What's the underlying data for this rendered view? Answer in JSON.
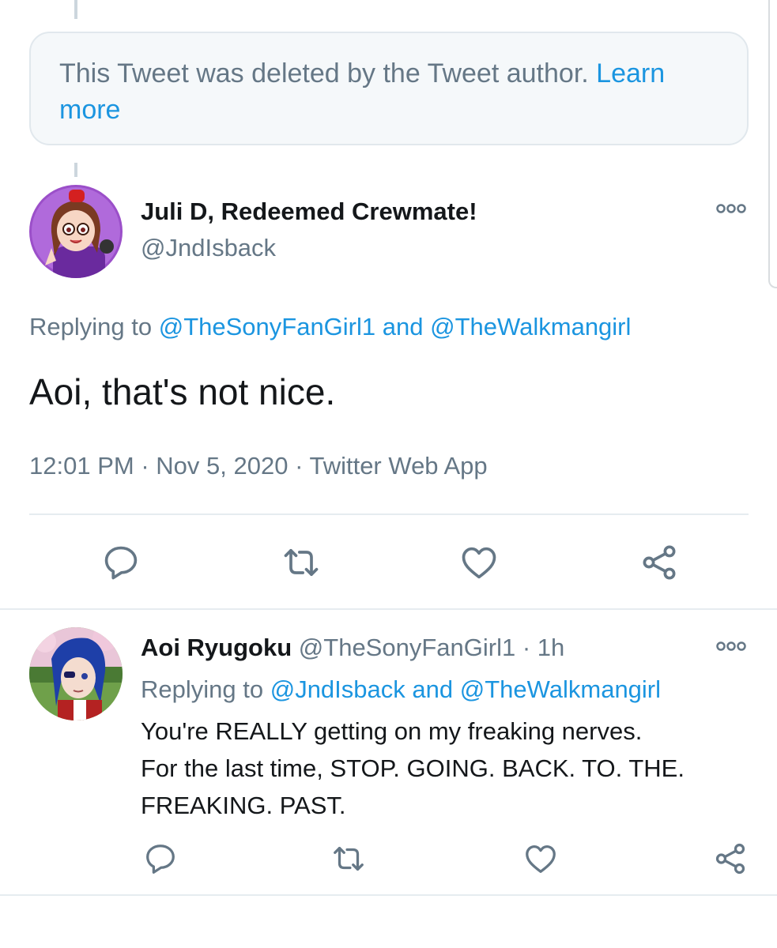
{
  "deleted_notice": {
    "text": "This Tweet was deleted by the Tweet author.",
    "link": "Learn more"
  },
  "main_tweet": {
    "display_name": "Juli D, Redeemed Crewmate!",
    "handle": "@JndIsback",
    "replying_to_label": "Replying to",
    "replying_to_user1": "@TheSonyFanGirl1",
    "replying_to_and": "and",
    "replying_to_user2": "@TheWalkmangirl",
    "text": "Aoi, that's not nice.",
    "time": "12:01 PM",
    "date": "Nov 5, 2020",
    "source": "Twitter Web App",
    "sep": "·"
  },
  "reply_tweet": {
    "display_name": "Aoi Ryugoku",
    "handle": "@TheSonyFanGirl1",
    "sep": "·",
    "age": "1h",
    "replying_to_label": "Replying to",
    "replying_to_user1": "@JndIsback",
    "replying_to_and": "and",
    "replying_to_user2": "@TheWalkmangirl",
    "text_line1": "You're REALLY getting on my freaking nerves.",
    "text_line2": "For the last time, STOP. GOING. BACK. TO. THE.",
    "text_line3": "FREAKING. PAST."
  },
  "icons": {
    "reply": "reply-icon",
    "retweet": "retweet-icon",
    "like": "heart-icon",
    "share": "share-icon",
    "more": "more-icon"
  },
  "colors": {
    "link": "#1b95e0",
    "muted": "#657786",
    "text": "#14171a",
    "icon": "#657786"
  }
}
